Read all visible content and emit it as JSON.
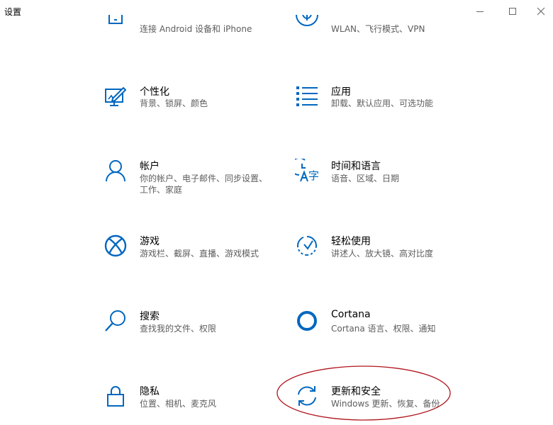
{
  "window": {
    "title": "设置",
    "controls": {
      "minimize_icon": "minimize-icon",
      "maximize_icon": "maximize-icon",
      "close_icon": "close-icon"
    }
  },
  "colors": {
    "accent": "#0067c0",
    "text": "#000000",
    "secondary_text": "#5d5d5d",
    "annotation": "#b0141c"
  },
  "tiles": [
    {
      "icon": "phone-icon",
      "title": "",
      "desc": "连接 Android 设备和 iPhone"
    },
    {
      "icon": "globe-icon",
      "title": "",
      "desc": "WLAN、飞行模式、VPN"
    },
    {
      "icon": "personalization-icon",
      "title": "个性化",
      "desc": "背景、锁屏、颜色"
    },
    {
      "icon": "apps-icon",
      "title": "应用",
      "desc": "卸载、默认应用、可选功能"
    },
    {
      "icon": "account-icon",
      "title": "帐户",
      "desc": "你的帐户、电子邮件、同步设置、工作、家庭"
    },
    {
      "icon": "time-language-icon",
      "title": "时间和语言",
      "desc": "语音、区域、日期"
    },
    {
      "icon": "xbox-icon",
      "title": "游戏",
      "desc": "游戏栏、截屏、直播、游戏模式"
    },
    {
      "icon": "ease-of-access-icon",
      "title": "轻松使用",
      "desc": "讲述人、放大镜、高对比度"
    },
    {
      "icon": "search-icon",
      "title": "搜索",
      "desc": "查找我的文件、权限"
    },
    {
      "icon": "cortana-icon",
      "title": "Cortana",
      "desc": "Cortana 语言、权限、通知"
    },
    {
      "icon": "lock-icon",
      "title": "隐私",
      "desc": "位置、相机、麦克风"
    },
    {
      "icon": "sync-icon",
      "title": "更新和安全",
      "desc": "Windows 更新、恢复、备份"
    }
  ],
  "annotation": {
    "type": "ellipse",
    "target": "更新和安全"
  }
}
